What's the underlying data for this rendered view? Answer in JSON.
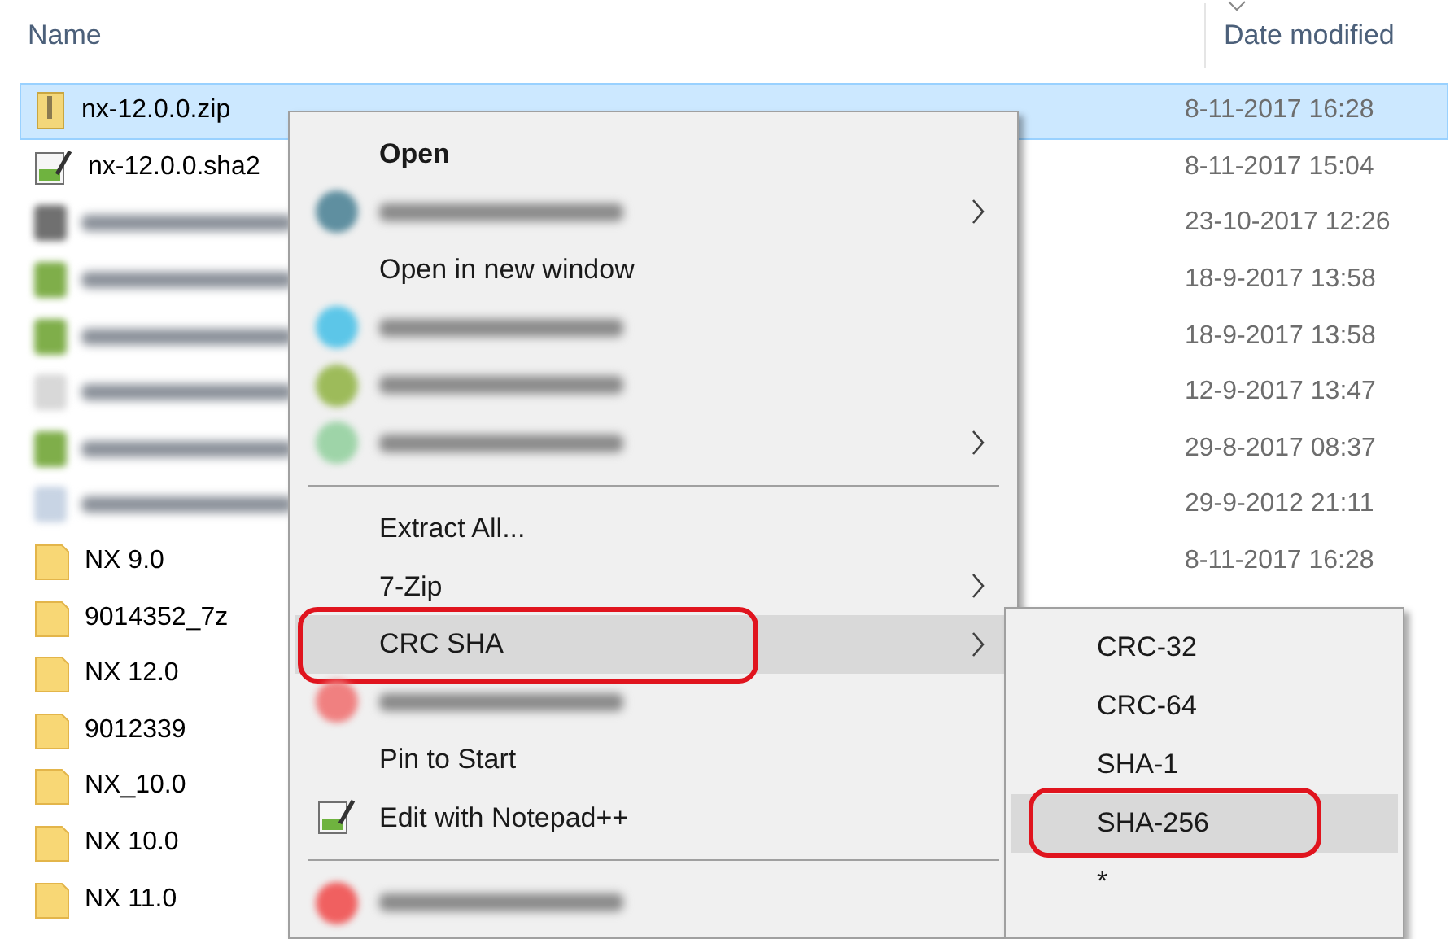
{
  "columns": [
    {
      "label": "Name"
    },
    {
      "label": "Date modified",
      "sorted": true
    }
  ],
  "rows": [
    {
      "kind": "zip",
      "name": "nx-12.0.0.zip",
      "date": "8-11-2017 16:28",
      "selected": true
    },
    {
      "kind": "text",
      "name": "nx-12.0.0.sha2",
      "date": "8-11-2017 15:04",
      "selected": false
    },
    {
      "kind": "blurred",
      "color": "#707070",
      "date": "23-10-2017 12:26",
      "selected": false
    },
    {
      "kind": "blurred",
      "color": "#7fae4a",
      "date": "18-9-2017 13:58",
      "selected": false
    },
    {
      "kind": "blurred",
      "color": "#7fae4a",
      "date": "18-9-2017 13:58",
      "selected": false
    },
    {
      "kind": "blurred",
      "color": "#d8d8d8",
      "date": "12-9-2017 13:47",
      "selected": false
    },
    {
      "kind": "blurred",
      "color": "#7fae4a",
      "date": "29-8-2017 08:37",
      "selected": false
    },
    {
      "kind": "blurred",
      "color": "#c8d4e4",
      "date": "29-9-2012 21:11",
      "selected": false
    },
    {
      "kind": "folder",
      "name": "NX 9.0",
      "date": "8-11-2017 16:28",
      "selected": false
    },
    {
      "kind": "folder",
      "name": "9014352_7z",
      "selected": false
    },
    {
      "kind": "folder",
      "name": "NX 12.0",
      "selected": false
    },
    {
      "kind": "folder",
      "name": "9012339",
      "selected": false
    },
    {
      "kind": "folder",
      "name": "NX_10.0",
      "selected": false
    },
    {
      "kind": "folder",
      "name": "NX 10.0",
      "selected": false
    },
    {
      "kind": "folder",
      "name": "NX 11.0",
      "selected": false
    }
  ],
  "context_menu": {
    "items": [
      {
        "kind": "item",
        "label": "Open",
        "bold": true,
        "submenu": false,
        "highlighted": false,
        "circled": false
      },
      {
        "kind": "blurred",
        "color": "#5f8fa0",
        "submenu": true,
        "highlighted": false,
        "circled": false
      },
      {
        "kind": "item",
        "label": "Open in new window",
        "bold": false,
        "submenu": false,
        "highlighted": false,
        "circled": false
      },
      {
        "kind": "blurred",
        "color": "#5cc6e8",
        "submenu": false,
        "highlighted": false,
        "circled": false
      },
      {
        "kind": "blurred",
        "color": "#9dbb5a",
        "submenu": false,
        "highlighted": false,
        "circled": false
      },
      {
        "kind": "blurred",
        "color": "#9ed4a8",
        "submenu": true,
        "highlighted": false,
        "circled": false
      },
      {
        "kind": "separator"
      },
      {
        "kind": "item",
        "label": "Extract All...",
        "bold": false,
        "submenu": false,
        "highlighted": false,
        "circled": false
      },
      {
        "kind": "item",
        "label": "7-Zip",
        "bold": false,
        "submenu": true,
        "highlighted": false,
        "circled": false
      },
      {
        "kind": "item",
        "label": "CRC SHA",
        "bold": false,
        "submenu": true,
        "highlighted": true,
        "circled": true
      },
      {
        "kind": "blurred",
        "color": "#f08080",
        "submenu": false,
        "highlighted": false,
        "circled": false
      },
      {
        "kind": "item",
        "label": "Pin to Start",
        "bold": false,
        "submenu": false,
        "highlighted": false,
        "circled": false
      },
      {
        "kind": "notepad",
        "label": "Edit with Notepad++",
        "bold": false,
        "submenu": false,
        "highlighted": false,
        "circled": false
      },
      {
        "kind": "separator"
      },
      {
        "kind": "blurred",
        "color": "#f06060",
        "submenu": false,
        "highlighted": false,
        "circled": false
      }
    ]
  },
  "submenu": {
    "items": [
      {
        "label": "CRC-32",
        "highlighted": false,
        "circled": false
      },
      {
        "label": "CRC-64",
        "highlighted": false,
        "circled": false
      },
      {
        "label": "SHA-1",
        "highlighted": false,
        "circled": false
      },
      {
        "label": "SHA-256",
        "highlighted": true,
        "circled": true
      },
      {
        "label": "*",
        "highlighted": false,
        "circled": false
      }
    ]
  }
}
